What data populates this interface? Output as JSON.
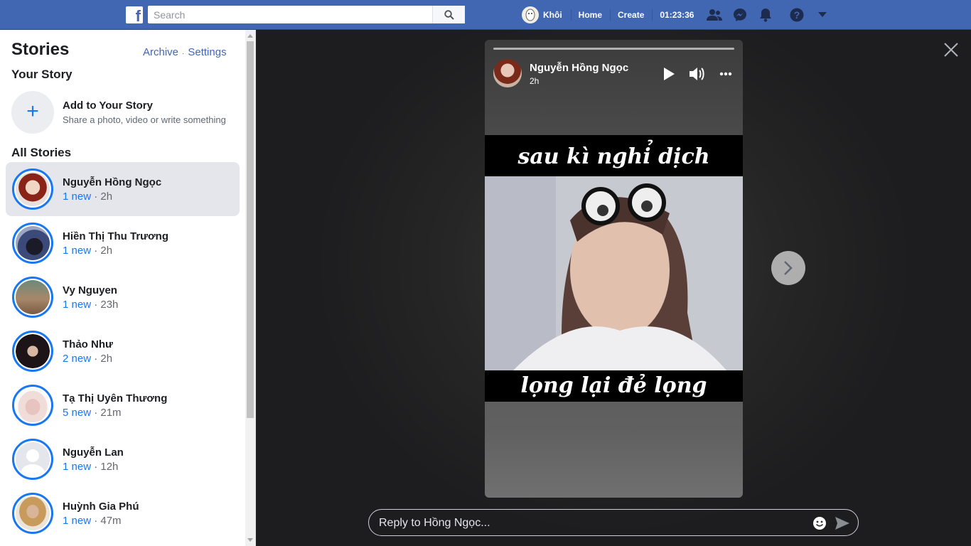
{
  "topbar": {
    "logo": "f",
    "search_placeholder": "Search",
    "user_name": "Khôi",
    "home_label": "Home",
    "create_label": "Create",
    "clock": "01:23:36",
    "icons": [
      "friends-icon",
      "messenger-icon",
      "notifications-icon",
      "help-icon",
      "menu-caret-icon"
    ]
  },
  "sidebar": {
    "title": "Stories",
    "archive_label": "Archive",
    "separator": "·",
    "settings_label": "Settings",
    "your_story_heading": "Your Story",
    "add_story": {
      "icon": "+",
      "title": "Add to Your Story",
      "subtitle": "Share a photo, video or write something"
    },
    "all_stories_heading": "All Stories",
    "stories": [
      {
        "name": "Nguyễn Hồng Ngọc",
        "new": "1 new",
        "time": "2h",
        "active": true
      },
      {
        "name": "Hiền Thị Thu Trương",
        "new": "1 new",
        "time": "2h"
      },
      {
        "name": "Vy Nguyen",
        "new": "1 new",
        "time": "23h"
      },
      {
        "name": "Thảo Như",
        "new": "2 new",
        "time": "2h"
      },
      {
        "name": "Tạ Thị Uyên Thương",
        "new": "5 new",
        "time": "21m"
      },
      {
        "name": "Nguyễn Lan",
        "new": "1 new",
        "time": "12h"
      },
      {
        "name": "Huỳnh Gia Phú",
        "new": "1 new",
        "time": "47m"
      }
    ],
    "meta_separator": " · "
  },
  "viewer": {
    "author": "Nguyễn Hồng Ngọc",
    "time": "2h",
    "caption_top": "sau kì nghỉ dịch",
    "caption_bottom": "lọng lại đẻ lọng",
    "reply_placeholder": "Reply to Hồng Ngọc...",
    "progress": 1.0
  },
  "colors": {
    "brand": "#4267b2",
    "accent": "#1877f2"
  }
}
